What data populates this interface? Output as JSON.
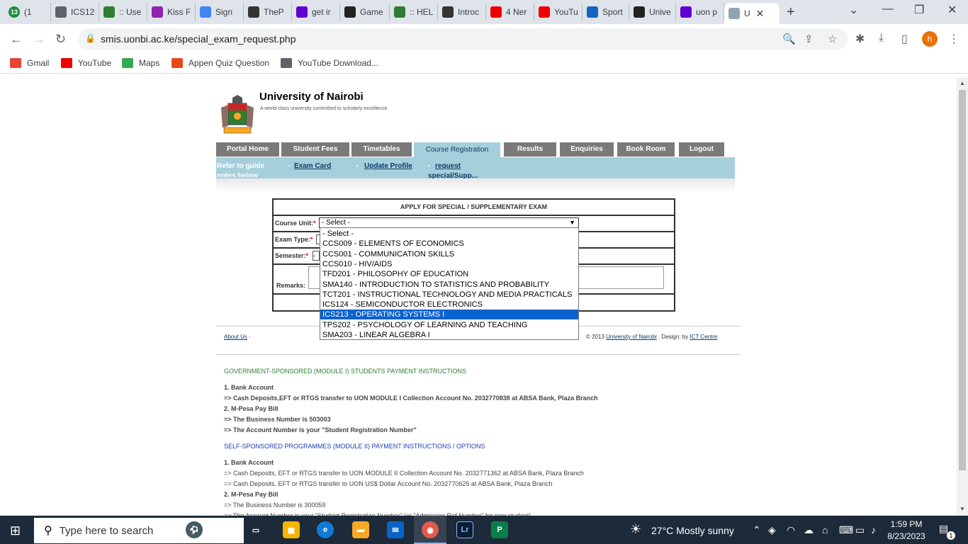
{
  "browser": {
    "tabs": [
      {
        "label": "(1",
        "badge": "13",
        "color": "#1e8e3e"
      },
      {
        "label": "ICS12",
        "color": "#5f6368"
      },
      {
        "label": ":: Use",
        "color": "#2e7d32"
      },
      {
        "label": "Kiss F",
        "color": "#8e24aa"
      },
      {
        "label": "Sign",
        "color": "#4285f4"
      },
      {
        "label": "TheP",
        "color": "#333"
      },
      {
        "label": "get ir",
        "color": "#6001d2"
      },
      {
        "label": "Game",
        "color": "#222"
      },
      {
        "label": ":: HEL",
        "color": "#2e7d32"
      },
      {
        "label": "Introc",
        "color": "#333"
      },
      {
        "label": "4 Ner",
        "color": "#e00"
      },
      {
        "label": "YouTu",
        "color": "#e00"
      },
      {
        "label": "Sport",
        "color": "#1565c0"
      },
      {
        "label": "Unive",
        "color": "#222"
      },
      {
        "label": "uon p",
        "color": "#6001d2"
      },
      {
        "label": "U",
        "color": "#90a4ae",
        "active": true
      }
    ],
    "url": "smis.uonbi.ac.ke/special_exam_request.php",
    "profile_initial": "h",
    "bookmarks": [
      {
        "label": "Gmail",
        "color": "#ea4335"
      },
      {
        "label": "YouTube",
        "color": "#e00"
      },
      {
        "label": "Maps",
        "color": "#34a853"
      },
      {
        "label": "Appen Quiz Question",
        "color": "#e64a19"
      },
      {
        "label": "YouTube Download...",
        "color": "#5f6368"
      }
    ]
  },
  "site": {
    "title": "University of Nairobi",
    "tagline": "A world-class university committed to scholarly excellence",
    "nav": [
      "Portal Home",
      "Student Fees",
      "Timetables",
      "Course Registration",
      "Results",
      "Enquiries",
      "Book Room",
      "Logout"
    ],
    "active_nav": "Course Registration",
    "subnav": {
      "guide": "Refer to guide notes below",
      "exam_card": "Exam Card",
      "update_profile": "Update Profile",
      "request": "request special/Supp..."
    }
  },
  "form": {
    "heading": "APPLY FOR SPECIAL / SUPPLEMENTARY EXAM",
    "course_unit_label": "Course Unit:",
    "exam_type_label": "Exam Type:",
    "semester_label": "Semester:",
    "remarks_label": "Remarks:",
    "required_mark": "*",
    "selected_value": "- Select -",
    "options": [
      "- Select -",
      "CCS009 - ELEMENTS OF ECONOMICS",
      "CCS001 - COMMUNICATION SKILLS",
      "CCS010 - HIV/AIDS",
      "TFD201 - PHILOSOPHY OF EDUCATION",
      "SMA140 - INTRODUCTION TO STATISTICS AND PROBABILITY",
      "TCT201 - INSTRUCTIONAL TECHNOLOGY AND MEDIA PRACTICALS",
      "ICS124 - SEMICONDUCTOR ELECTRONICS",
      "ICS213 - OPERATING SYSTEMS I",
      "TPS202 - PSYCHOLOGY OF LEARNING AND TEACHING",
      "SMA203 - LINEAR ALGEBRA I"
    ],
    "highlighted_option": "ICS213 - OPERATING SYSTEMS I"
  },
  "footer": {
    "about": "About Us",
    "about_sep": "·",
    "copyright_prefix": "© 2013",
    "uni_link": "University of Nairobi",
    "design_by": ". Design: by",
    "ict": "ICT Centre"
  },
  "info": {
    "gov_head": "GOVERNMENT-SPONSORED (MODULE I) STUDENTS PAYMENT INSTRUCTIONS",
    "gov": [
      "1. Bank Account",
      "=> Cash Deposits,EFT or RTGS transfer to UON MODULE I Collection Account No. 2032770838 at ABSA Bank, Plaza Branch",
      "2. M-Pesa Pay Bill",
      "=> The Business Number is 503003",
      "=> The Account Number is your \"Student Registration Number\""
    ],
    "self_head": "SELF-SPONSORED PROGRAMMES (MODULE II) PAYMENT INSTRUCTIONS / OPTIONS",
    "self": [
      "1. Bank Account",
      "=> Cash Deposits, EFT or RTGS transfer to UON MODULE II Collection Account No. 2032771362 at ABSA Bank, Plaza Branch",
      "=> Cash Deposits, EFT or RTGS transfer to UON US$ Dollar Account No. 2032770625 at ABSA Bank, Plaza Branch",
      "2. M-Pesa Pay Bill",
      "=> The Business Number is 300059",
      "=> The Account Number is your \"Student Registration Number\" (or \"Admission Ref Number\" for new student)"
    ]
  },
  "taskbar": {
    "search_placeholder": "Type here to search",
    "weather": "27°C  Mostly sunny",
    "time": "1:59 PM",
    "date": "8/23/2023",
    "notifications": "1"
  }
}
